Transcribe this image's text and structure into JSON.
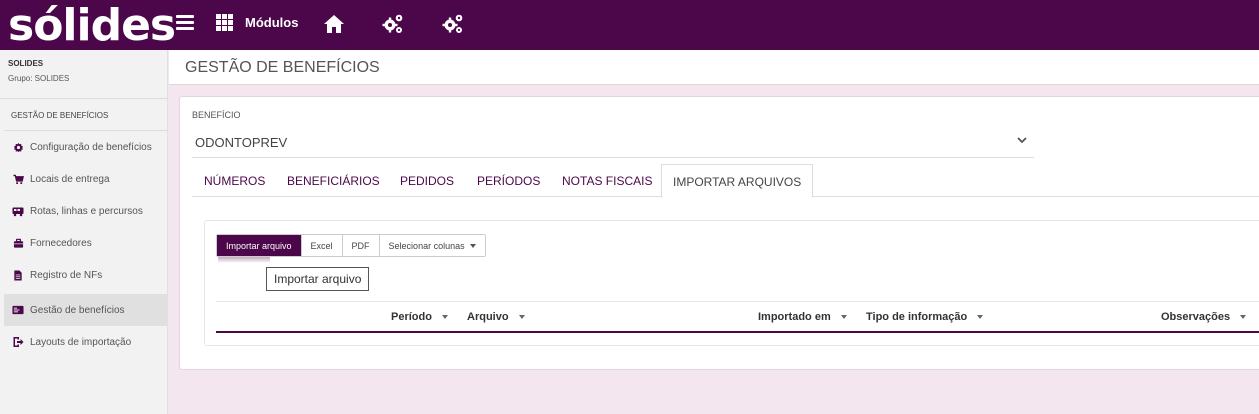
{
  "topbar": {
    "logo": "sólides",
    "modules_label": "Módulos",
    "icons": [
      "menu-icon",
      "apps-grid-icon",
      "home-icon",
      "gears-icon",
      "gears-icon"
    ]
  },
  "sidebar": {
    "org_name": "SOLIDES",
    "org_group": "Grupo: SOLIDES",
    "section_title": "GESTÃO DE BENEFÍCIOS",
    "items": [
      {
        "label": "Configuração de benefícios",
        "icon": "gear-icon"
      },
      {
        "label": "Locais de entrega",
        "icon": "cart-icon"
      },
      {
        "label": "Rotas, linhas e percursos",
        "icon": "bus-icon"
      },
      {
        "label": "Fornecedores",
        "icon": "briefcase-icon"
      },
      {
        "label": "Registro de NFs",
        "icon": "document-icon"
      },
      {
        "label": "Gestão de benefícios",
        "icon": "card-icon",
        "active": true
      },
      {
        "label": "Layouts de importação",
        "icon": "import-icon"
      }
    ]
  },
  "page": {
    "title": "GESTÃO DE BENEFÍCIOS"
  },
  "benefit": {
    "label": "BENEFÍCIO",
    "value": "ODONTOPREV"
  },
  "tabs": [
    {
      "label": "NÚMEROS"
    },
    {
      "label": "BENEFICIÁRIOS"
    },
    {
      "label": "PEDIDOS"
    },
    {
      "label": "PERÍODOS"
    },
    {
      "label": "NOTAS FISCAIS"
    },
    {
      "label": "IMPORTAR ARQUIVOS",
      "active": true
    }
  ],
  "toolbar": {
    "import_label": "Importar arquivo",
    "excel_label": "Excel",
    "pdf_label": "PDF",
    "columns_label": "Selecionar colunas"
  },
  "tooltip": "Importar arquivo",
  "grid": {
    "columns": [
      "Período",
      "Arquivo",
      "Importado em",
      "Tipo de informação",
      "Observações"
    ]
  },
  "colors": {
    "brand": "#4b0749",
    "background": "#f3e6ee"
  }
}
